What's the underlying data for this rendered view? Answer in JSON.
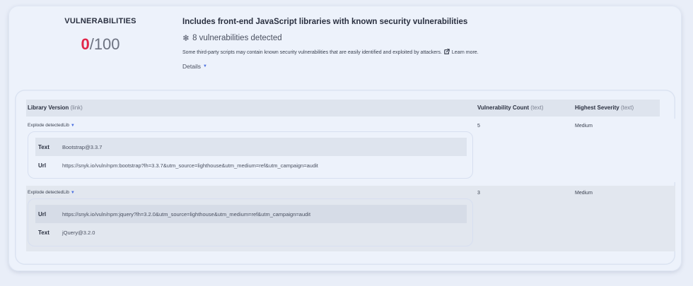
{
  "score": {
    "label": "VULNERABILITIES",
    "value": "0",
    "max": "/100"
  },
  "audit": {
    "title": "Includes front-end JavaScript libraries with known security vulnerabilities",
    "count_text": "8 vulnerabilities detected",
    "description": "Some third-party scripts may contain known security vulnerabilities that are easily identified and exploited by attackers.",
    "learn_more": "Learn more.",
    "details": "Details"
  },
  "table": {
    "columns": [
      {
        "name": "Library Version",
        "hint": "(link)"
      },
      {
        "name": "Vulnerability Count",
        "hint": "(text)"
      },
      {
        "name": "Highest Severity",
        "hint": "(text)"
      }
    ],
    "rows": [
      {
        "explode": "Explode detectedLib",
        "count": "5",
        "severity": "Medium",
        "sub": [
          {
            "key": "Text",
            "value": "Bootstrap@3.3.7"
          },
          {
            "key": "Url",
            "value": "https://snyk.io/vuln/npm:bootstrap?lh=3.3.7&utm_source=lighthouse&utm_medium=ref&utm_campaign=audit"
          }
        ]
      },
      {
        "explode": "Explode detectedLib",
        "count": "3",
        "severity": "Medium",
        "sub": [
          {
            "key": "Url",
            "value": "https://snyk.io/vuln/npm:jquery?lh=3.2.0&utm_source=lighthouse&utm_medium=ref&utm_campaign=audit"
          },
          {
            "key": "Text",
            "value": "jQuery@3.2.0"
          }
        ]
      }
    ]
  },
  "colors": {
    "score_fail": "#e1264a",
    "accent": "#4a6fe0"
  },
  "icons": {
    "count": "snowflake-icon",
    "link": "external-link-icon",
    "expand": "caret-down-icon"
  }
}
